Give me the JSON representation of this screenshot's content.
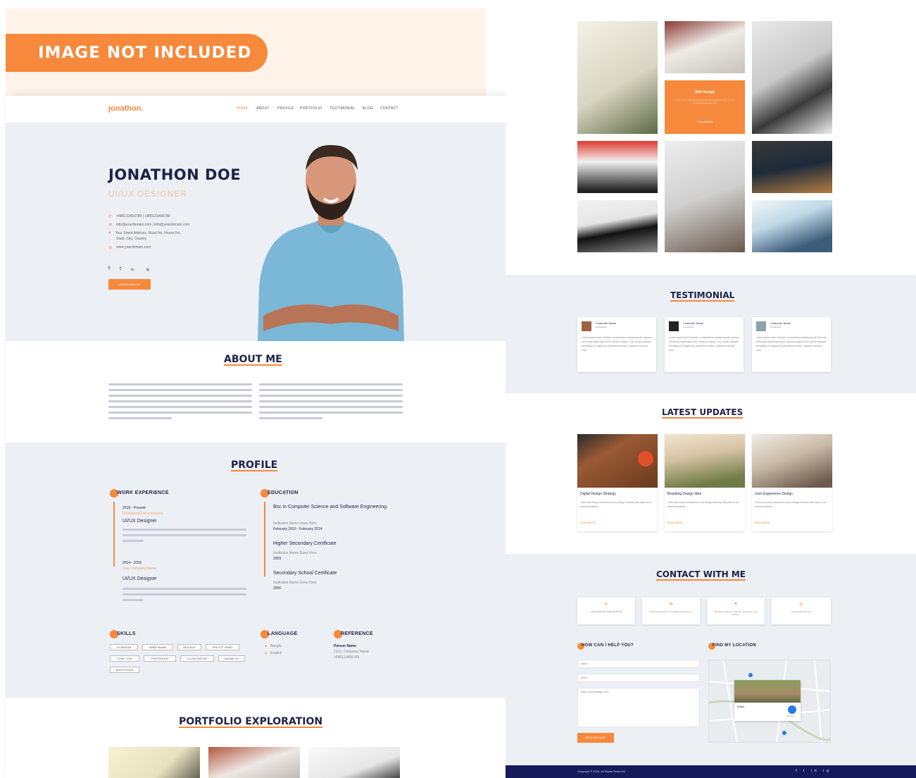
{
  "banner": {
    "badge": "IMAGE NOT INCLUDED"
  },
  "nav": {
    "logo": "jonathon.",
    "items": [
      "HOME",
      "ABOUT",
      "PROFILE",
      "PORTFOLIO",
      "TESTIMONIAL",
      "BLOG",
      "CONTACT"
    ]
  },
  "hero": {
    "name": "JONATHON DOE",
    "role": "UI/UX DESIGNER",
    "contact": [
      "+880123456789 | +880123456789",
      "info@yourdomain.com | info@yourdomain.com",
      "Your Street Address, Road No, House No,",
      "State, City, Country",
      "www.yourdomain.com"
    ],
    "social": [
      "f",
      "t",
      "in",
      "ig"
    ],
    "download_button": "DOWNLOAD CV"
  },
  "about": {
    "title": "ABOUT ME",
    "col1": "Lorem ipsum dolor sit amet, consectetuer adipiscing elit. Aenean commodo ligula eget dolor. Aenean massa. Cum sociis natoque penatibus et magnis dis parturient montes nascetur ridiculus mus. Donec quam felis, ultricies nec, pellentesque eu, pretium quis, sem. Nulla consequat massa quis enim. Donec pede justo, fringilla vel, aliquet nec, vulputate eget, arcu.",
    "col2": "Lorem ipsum dolor sit amet, consectetuer adipiscing elit. Aenean commodo ligula eget dolor. Aenean massa. Cum sociis natoque penatibus et magnis dis parturient montes nascetur ridiculus mus. Donec quam felis, ultricies nec, pellentesque eu, pretium quis, sem. Nulla consequat massa quis enim. Donec pede justo, fringilla vel, aliquet nec, vulputate eget, arcu."
  },
  "profile": {
    "title": "PROFILE",
    "work_heading": "WORK EXPERIENCE",
    "work": [
      {
        "date": "2018 - Present",
        "company": "Freelancer/Self employed",
        "role": "UI/UX Designer",
        "desc": "Lorem ipsum dolor sit amet, consectetuer adipiscing elit. Aenean commodo ligula eget dolor. Aenean massa."
      },
      {
        "date": "2014 - 2018",
        "company": "Your Company Name",
        "role": "UI/UX Designer",
        "desc": "Lorem ipsum dolor sit amet, consectetuer adipiscing elit. Aenean commodo ligula eget dolor. Aenean massa."
      }
    ],
    "edu_heading": "EDUCATION",
    "education": [
      {
        "title": "Bsc in Computer Science and Software Engineering",
        "inst": "Institution Name Goes Here",
        "date": "February 2010 - February 2014"
      },
      {
        "title": "Higher Secondary Certificate",
        "inst": "Institution Name Goes Here",
        "date": "2009"
      },
      {
        "title": "Secondary School Certificate",
        "inst": "Institution Name Goes Here",
        "date": "2006"
      }
    ],
    "skills_heading": "SKILLS",
    "skills": [
      "UI DESIGN",
      "WIREFRAME",
      "MOCKUP",
      "PROTOTYPING",
      "HTML, CSS",
      "PHOTOSHOP",
      "ILLUSTRATOR",
      "ADOBE XD",
      "BOOTSTRAP"
    ],
    "language_heading": "LANGUAGE",
    "languages": [
      "Bangla",
      "English"
    ],
    "reference_heading": "REFERENCE",
    "reference": [
      "Person Name",
      "CEO, Company Name",
      "+880123456789"
    ]
  },
  "portfolio": {
    "title": "PORTFOLIO EXPLORATION",
    "overlay_title": "Web Design",
    "overlay_text": "Lorem ipsum dolor sit amet, consectetuer adipiscing elit. Aenean commodo ligula eget dolor.",
    "overlay_link": "View Details"
  },
  "testimonial": {
    "title": "TESTIMONIAL",
    "cards": [
      {
        "name": "Customer Name",
        "role": "Designation",
        "text": "Lorem ipsum dolor sit amet, consectetuer adipiscing elit. Aenean commodo ligula eget dolor. Aenean massa. Cum sociis natoque penatibus et magnis dis parturient montes, nascetur ridiculus mus."
      },
      {
        "name": "Customer Name",
        "role": "Designation",
        "text": "Lorem ipsum dolor sit amet, consectetuer adipiscing elit. Aenean commodo ligula eget dolor. Aenean massa. Cum sociis natoque penatibus et magnis dis parturient montes, nascetur ridiculus mus."
      },
      {
        "name": "Customer Name",
        "role": "Designation",
        "text": "Lorem ipsum dolor sit amet, consectetuer adipiscing elit. Aenean commodo ligula eget dolor. Aenean massa. Cum sociis natoque penatibus et magnis dis parturient montes, nascetur ridiculus mus."
      }
    ]
  },
  "updates": {
    "title": "LATEST UPDATES",
    "posts": [
      {
        "title": "Digital Design Strategy",
        "text": "There are many companies in the design industry that claim to be transformational.",
        "link": "READ MORE"
      },
      {
        "title": "Branding Design Idea",
        "text": "There are many companies in the design industry that claim to be transformational.",
        "link": "READ MORE"
      },
      {
        "title": "User Experience Design",
        "text": "There are many companies in the design industry that claim to be transformational.",
        "link": "READ MORE"
      }
    ]
  },
  "contact": {
    "title": "CONTACT WITH ME",
    "boxes": [
      "+880123456789 +880123456789",
      "info@yourdomain.com info@yourdomain.com",
      "123 Street Address, Road No, House No, City, Country",
      "www.yourdomain.com"
    ],
    "help_heading": "HOW CAN I HELP YOU?",
    "name_placeholder": "Name",
    "email_placeholder": "Email",
    "message_placeholder": "Write your Message Here",
    "send_button": "SEND MESSAGE",
    "location_heading": "FIND MY LOCATION",
    "map_label": "Dhaka",
    "map_directions": "Directions"
  },
  "footer": {
    "copyright": "Copyright © 2020, All Rights Reserved",
    "social": "f t in ig"
  },
  "colors": {
    "accent": "#f6893b",
    "navy": "#1d2348",
    "light_bg": "#eceff4",
    "footer": "#151a5b"
  }
}
